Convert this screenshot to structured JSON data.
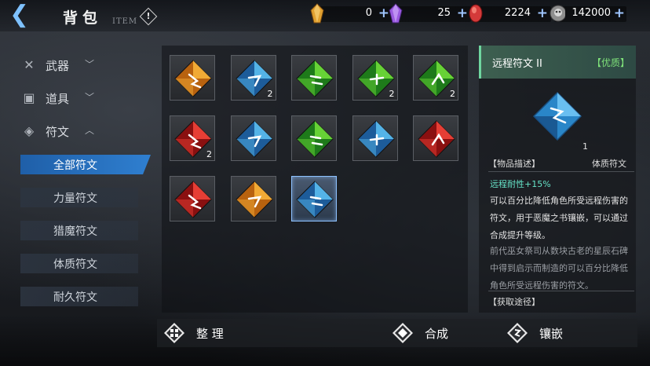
{
  "header": {
    "back_icon": "back-arrow-icon",
    "title": "背包",
    "subtitle": "ITEM",
    "info_icon": "exclamation-icon",
    "info_label": "!"
  },
  "currencies": [
    {
      "icon": "amber-crystal-icon",
      "value": "0",
      "plus": "+",
      "color": "#e0a030"
    },
    {
      "icon": "purple-crystal-icon",
      "value": "25",
      "plus": "+",
      "color": "#9a5ae0"
    },
    {
      "icon": "red-crystal-icon",
      "value": "2224",
      "plus": "+",
      "color": "#d43a3a"
    },
    {
      "icon": "skull-coin-icon",
      "value": "142000",
      "plus": "+",
      "color": "#b8b8b8"
    }
  ],
  "nav": {
    "categories": [
      {
        "label": "武器",
        "icon": "sword-icon",
        "chevron": "﹀"
      },
      {
        "label": "道具",
        "icon": "gift-box-icon",
        "chevron": "﹀"
      },
      {
        "label": "符文",
        "icon": "rune-icon",
        "chevron": "︿"
      }
    ],
    "rune_subs": [
      "全部符文",
      "力量符文",
      "猎魔符文",
      "体质符文",
      "耐久符文"
    ]
  },
  "inventory": {
    "slots": [
      {
        "color": "orange",
        "count": ""
      },
      {
        "color": "blue",
        "count": "2"
      },
      {
        "color": "green",
        "count": ""
      },
      {
        "color": "green",
        "count": "2"
      },
      {
        "color": "green",
        "count": "2"
      },
      {
        "color": "red",
        "count": "2"
      },
      {
        "color": "blue",
        "count": ""
      },
      {
        "color": "green",
        "count": ""
      },
      {
        "color": "blue",
        "count": ""
      },
      {
        "color": "red",
        "count": ""
      },
      {
        "color": "red",
        "count": ""
      },
      {
        "color": "orange",
        "count": ""
      },
      {
        "color": "blue",
        "count": "",
        "selected": true
      }
    ],
    "palette": {
      "orange": [
        "#f7b23a",
        "#b8620f"
      ],
      "blue": [
        "#5bbcf0",
        "#1d5c9a"
      ],
      "green": [
        "#6fdc3a",
        "#1e7a1a"
      ],
      "red": [
        "#f0443a",
        "#8a1010"
      ]
    }
  },
  "detail": {
    "name": "远程符文 II",
    "quality": "【优质】",
    "count": "1",
    "desc_label": "【物品描述】",
    "type": "体质符文",
    "stat": "远程耐性+15%",
    "text": "可以百分比降低角色所受远程伤害的符文，用于恶魔之书镶嵌，可以通过合成提升等级。",
    "lore": "前代巫女祭司从数块古老的星辰石碑中得到启示而制造的可以百分比降低角色所受远程伤害的符文。",
    "source": "【获取途径】"
  },
  "actions": {
    "sort": {
      "label": "整 理",
      "icon": "grid-sort-icon"
    },
    "combine": {
      "label": "合成",
      "icon": "combine-diamond-icon"
    },
    "inlay": {
      "label": "镶嵌",
      "icon": "inlay-gem-icon"
    }
  }
}
